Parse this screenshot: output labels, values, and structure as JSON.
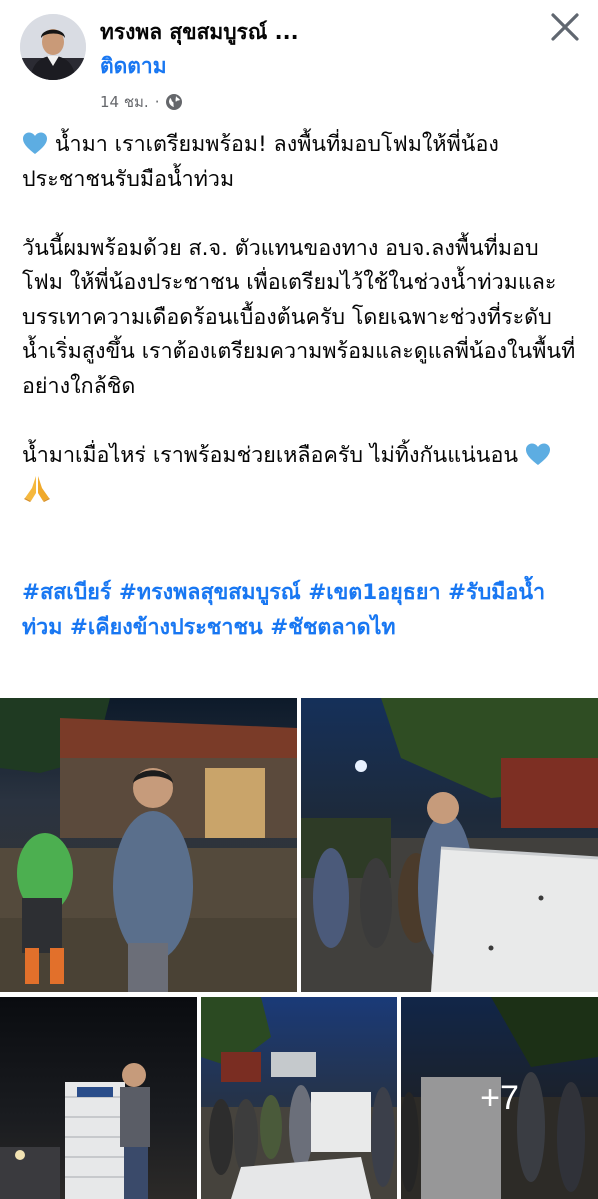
{
  "post": {
    "author": "ทรงพล สุขสมบูรณ์ ...",
    "follow_label": "ติดตาม",
    "time": "14 ชม.",
    "separator": "·",
    "privacy_icon": "globe-icon",
    "close_icon": "close-icon"
  },
  "body": {
    "p1": " น้ำมา เราเตรียมพร้อม! ลงพื้นที่มอบโฟมให้พี่น้องประชาชนรับมือน้ำท่วม",
    "p2": "วันนี้ผมพร้อมด้วย ส.จ. ตัวแทนของทาง อบจ.ลงพื้นที่มอบโฟม ให้พี่น้องประชาชน เพื่อเตรียมไว้ใช้ในช่วงน้ำท่วมและบรรเทาความเดือดร้อนเบื้องต้นครับ โดยเฉพาะช่วงที่ระดับน้ำเริ่มสูงขึ้น เราต้องเตรียมความพร้อมและดูแลพี่น้องในพื้นที่อย่างใกล้ชิด",
    "p3": "น้ำมาเมื่อไหร่ เราพร้อมช่วยเหลือครับ ไม่ทิ้งกันแน่นอน ",
    "heart_icon": "blue-heart-icon",
    "pray_icon": "folded-hands-icon"
  },
  "hashtags": [
    "#สสเบียร์",
    "#ทรงพลสุขสมบูรณ์",
    "#เขต1อยุธยา",
    "#รับมือน้ำท่วม",
    "#เคียงข้างประชาชน",
    "#ชัชตลาดไท"
  ],
  "photos": {
    "more_label": "+7"
  },
  "colors": {
    "link": "#1877f2",
    "meta": "#65676b",
    "text": "#050505",
    "heart": "#5dade2"
  }
}
